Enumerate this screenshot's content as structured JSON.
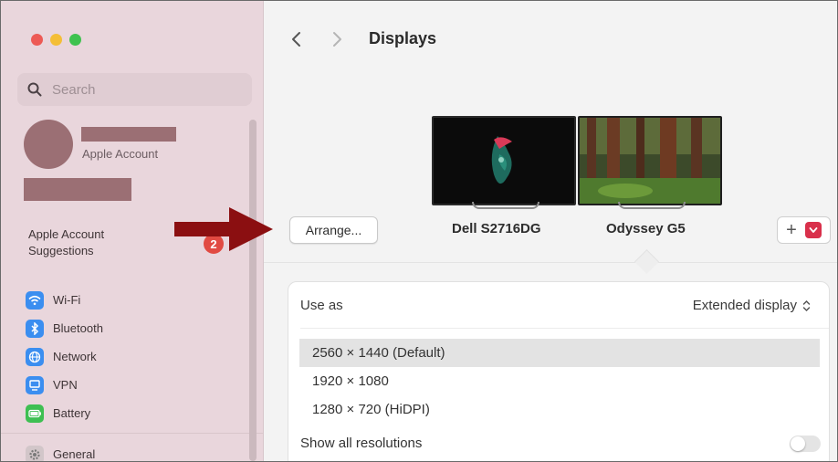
{
  "window": {
    "title": "Displays"
  },
  "colors": {
    "sidebar_bg": "#e9d6dc",
    "accent_red": "#d9304b",
    "annotation_arrow": "#8b0f11",
    "badge_red": "#e14a42"
  },
  "sidebar": {
    "search": {
      "placeholder": "Search",
      "icon": "search-icon"
    },
    "account": {
      "label": "Apple Account"
    },
    "suggestions": {
      "label_line1": "Apple Account",
      "label_line2": "Suggestions",
      "badge": "2"
    },
    "items": [
      {
        "label": "Wi-Fi",
        "icon": "wifi-icon",
        "color": "#3b8ef0"
      },
      {
        "label": "Bluetooth",
        "icon": "bluetooth-icon",
        "color": "#3b8ef0"
      },
      {
        "label": "Network",
        "icon": "globe-icon",
        "color": "#3b8ef0"
      },
      {
        "label": "VPN",
        "icon": "vpn-icon",
        "color": "#3b8ef0"
      },
      {
        "label": "Battery",
        "icon": "battery-icon",
        "color": "#3ebf52"
      },
      {
        "label": "General",
        "icon": "gear-icon",
        "color": "#9a9a9a"
      }
    ]
  },
  "main": {
    "title": "Displays",
    "arrange_button": "Arrange...",
    "monitors": [
      {
        "name": "Dell S2716DG"
      },
      {
        "name": "Odyssey G5"
      }
    ],
    "add_button": "+",
    "use_as": {
      "label": "Use as",
      "value": "Extended display"
    },
    "resolutions": [
      {
        "label": "2560 × 1440 (Default)",
        "selected": true
      },
      {
        "label": "1920 × 1080",
        "selected": false
      },
      {
        "label": "1280 × 720 (HiDPI)",
        "selected": false
      }
    ],
    "show_all_resolutions": {
      "label": "Show all resolutions",
      "enabled": false
    }
  }
}
